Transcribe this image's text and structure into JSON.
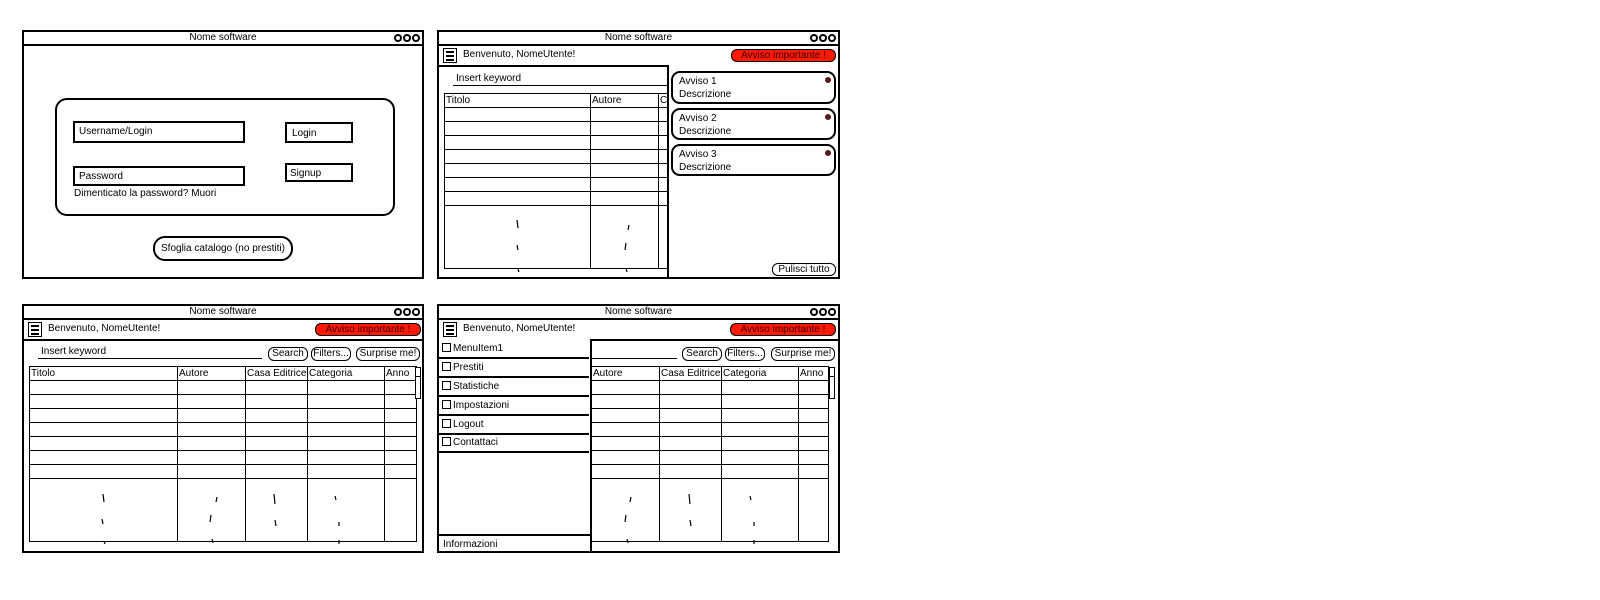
{
  "app_title": "Nome software",
  "login": {
    "username_placeholder": "Username/Login",
    "password_placeholder": "Password",
    "login_label": "Login",
    "signup_label": "Signup",
    "forgot_text": "Dimenticato la password? Muori",
    "browse_label": "Sfoglia catalogo (no prestiti)"
  },
  "header": {
    "welcome": "Benvenuto, NomeUtente!",
    "alert_label": "Avviso importante !",
    "alert_color": "#ff1a00",
    "menu_icon": "hamburger-icon"
  },
  "search": {
    "placeholder": "Insert keyword",
    "search_label": "Search",
    "filters_label": "Filters...",
    "surprise_label": "Surprise me!"
  },
  "table": {
    "columns": [
      "Titolo",
      "Autore",
      "Casa Editrice",
      "Categoria",
      "Anno"
    ],
    "partial_col": "C"
  },
  "notifications": {
    "items": [
      {
        "title": "Avviso 1",
        "desc": "Descrizione"
      },
      {
        "title": "Avviso 2",
        "desc": "Descrizione"
      },
      {
        "title": "Avviso 3",
        "desc": "Descrizione"
      }
    ],
    "clear_label": "Pulisci tutto"
  },
  "side_menu": {
    "items": [
      "MenuItem1",
      "Prestiti",
      "Statistiche",
      "Impostazioni",
      "Logout",
      "Contattaci"
    ],
    "footer": "Informazioni"
  }
}
